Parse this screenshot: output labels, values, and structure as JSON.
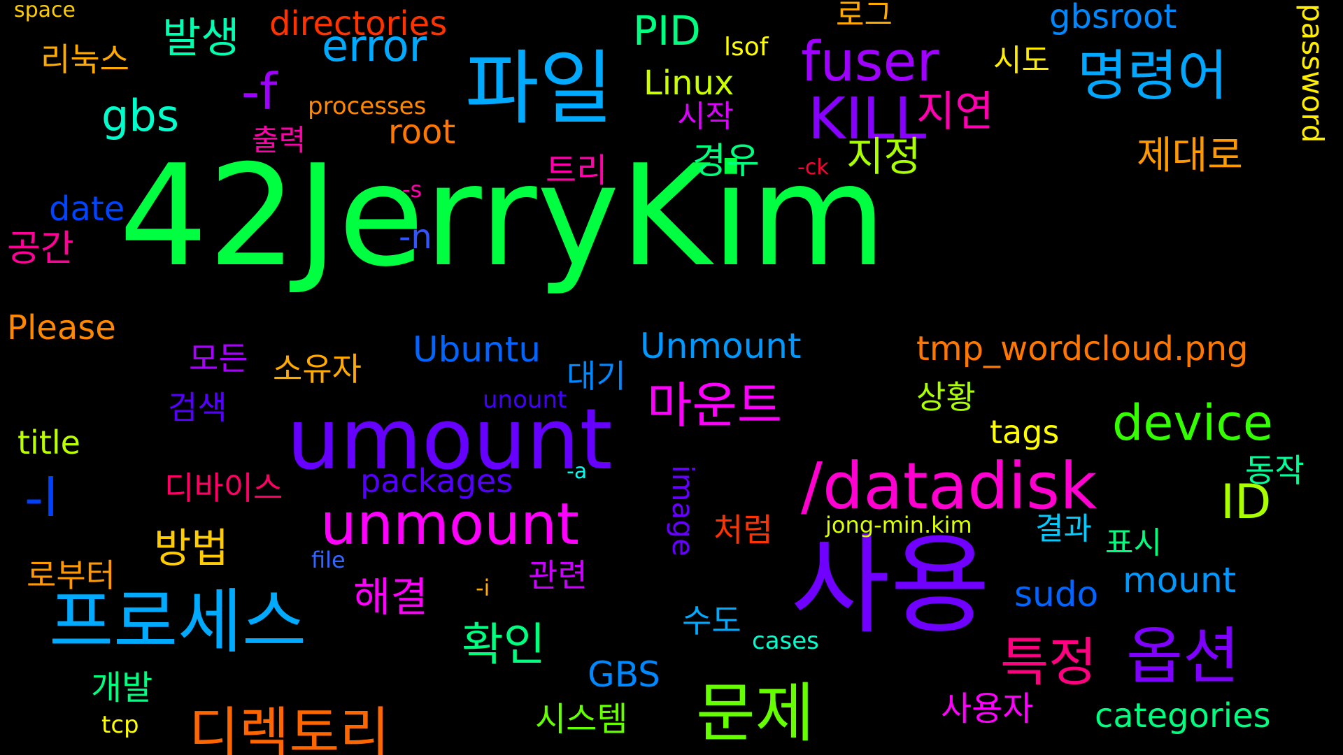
{
  "words": [
    {
      "text": "42JerryKim",
      "color": "#00ff40"
    },
    {
      "text": "사용",
      "color": "#7000ff"
    },
    {
      "text": "umount",
      "color": "#6600ff"
    },
    {
      "text": "파일",
      "color": "#00aaff"
    },
    {
      "text": "프로세스",
      "color": "#00aaff"
    },
    {
      "text": "/datadisk",
      "color": "#ff00d0"
    },
    {
      "text": "문제",
      "color": "#66ff00"
    },
    {
      "text": "옵션",
      "color": "#8000ff"
    },
    {
      "text": "unmount",
      "color": "#ff00ff"
    },
    {
      "text": "명령어",
      "color": "#00a8ff"
    },
    {
      "text": "fuser",
      "color": "#a000ff"
    },
    {
      "text": "KILL",
      "color": "#8800ff"
    },
    {
      "text": "디렉토리",
      "color": "#ff6600"
    },
    {
      "text": "특정",
      "color": "#ff0080"
    },
    {
      "text": "마운트",
      "color": "#ff00ff"
    },
    {
      "text": "device",
      "color": "#33ff00"
    },
    {
      "text": "확인",
      "color": "#00ff80"
    },
    {
      "text": "-f",
      "color": "#a000ff"
    },
    {
      "text": "error",
      "color": "#00aaff"
    },
    {
      "text": "PID",
      "color": "#00ff80"
    },
    {
      "text": "gbs",
      "color": "#00ffcc"
    },
    {
      "text": "발생",
      "color": "#00ffb0"
    },
    {
      "text": "지연",
      "color": "#ff00b0"
    },
    {
      "text": "제대로",
      "color": "#ff9900"
    },
    {
      "text": "지정",
      "color": "#aaff00"
    },
    {
      "text": "경우",
      "color": "#00ff80"
    },
    {
      "text": "ID",
      "color": "#aaff00"
    },
    {
      "text": "-l",
      "color": "#0040ff"
    },
    {
      "text": "방법",
      "color": "#ffcc00"
    },
    {
      "text": "해결",
      "color": "#ff00ff"
    },
    {
      "text": "root",
      "color": "#ff7700"
    },
    {
      "text": "Linux",
      "color": "#ccff00"
    },
    {
      "text": "gbsroot",
      "color": "#0088ff"
    },
    {
      "text": "로그",
      "color": "#ffaa00"
    },
    {
      "text": "시도",
      "color": "#ffee00"
    },
    {
      "text": "리눅스",
      "color": "#ffaa00"
    },
    {
      "text": "directories",
      "color": "#ff3300"
    },
    {
      "text": "space",
      "color": "#ffcc00"
    },
    {
      "text": "lsof",
      "color": "#ffff00"
    },
    {
      "text": "processes",
      "color": "#ff8800"
    },
    {
      "text": "시작",
      "color": "#dd00ff"
    },
    {
      "text": "출력",
      "color": "#ff00aa"
    },
    {
      "text": "트리",
      "color": "#ff00aa"
    },
    {
      "text": "-ck",
      "color": "#ff0033"
    },
    {
      "text": "-s",
      "color": "#ff00aa"
    },
    {
      "text": "date",
      "color": "#0044ff"
    },
    {
      "text": "공간",
      "color": "#ff0099"
    },
    {
      "text": "-n",
      "color": "#3355ff"
    },
    {
      "text": "password",
      "color": "#ffee00"
    },
    {
      "text": "Please",
      "color": "#ff8800"
    },
    {
      "text": "tmp_wordcloud.png",
      "color": "#ff7700"
    },
    {
      "text": "Ubuntu",
      "color": "#0066ff"
    },
    {
      "text": "Unmount",
      "color": "#0099ff"
    },
    {
      "text": "모든",
      "color": "#aa00ff"
    },
    {
      "text": "소유자",
      "color": "#ffaa00"
    },
    {
      "text": "대기",
      "color": "#0088ff"
    },
    {
      "text": "검색",
      "color": "#5500ff"
    },
    {
      "text": "unount",
      "color": "#4400ff"
    },
    {
      "text": "상황",
      "color": "#aaff00"
    },
    {
      "text": "tags",
      "color": "#ffff00"
    },
    {
      "text": "title",
      "color": "#bbff00"
    },
    {
      "text": "packages",
      "color": "#5500ff"
    },
    {
      "text": "-a",
      "color": "#00ffee"
    },
    {
      "text": "동작",
      "color": "#00ff99"
    },
    {
      "text": "디바이스",
      "color": "#ff0066"
    },
    {
      "text": "image",
      "color": "#6600ff"
    },
    {
      "text": "jong-min.kim",
      "color": "#ddff00"
    },
    {
      "text": "결과",
      "color": "#00ccff"
    },
    {
      "text": "표시",
      "color": "#00ff80"
    },
    {
      "text": "처럼",
      "color": "#ff3300"
    },
    {
      "text": "file",
      "color": "#3366ff"
    },
    {
      "text": "로부터",
      "color": "#ff9900"
    },
    {
      "text": "관련",
      "color": "#cc00ff"
    },
    {
      "text": "mount",
      "color": "#0099ff"
    },
    {
      "text": "sudo",
      "color": "#0066ff"
    },
    {
      "text": "-i",
      "color": "#ffaa00"
    },
    {
      "text": "수도",
      "color": "#00aaff"
    },
    {
      "text": "cases",
      "color": "#00ffcc"
    },
    {
      "text": "GBS",
      "color": "#0088ff"
    },
    {
      "text": "개발",
      "color": "#00ff80"
    },
    {
      "text": "시스템",
      "color": "#66ff00"
    },
    {
      "text": "사용자",
      "color": "#ff00ff"
    },
    {
      "text": "categories",
      "color": "#00ff80"
    },
    {
      "text": "tcp",
      "color": "#ffff00"
    }
  ]
}
